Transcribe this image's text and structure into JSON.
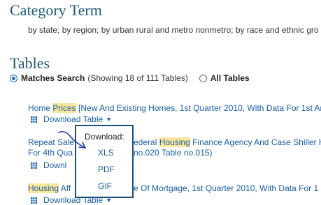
{
  "category": {
    "heading": "Category Term",
    "description": "by state; by region; by urban rural and metro nonmetro; by race and ethnic gro"
  },
  "tables": {
    "heading": "Tables",
    "matches_label": "Matches Search",
    "matches_count": "(Showing 18 of 111 Tables)",
    "all_label": "All Tables"
  },
  "results": [
    {
      "line1_pre": "Home ",
      "line1_hl": "Prices",
      "line1_post": " [New And Existing Homes, 1st Quarter 2010, With Data For 1st Ar"
    },
    {
      "line1_pre": "Repeat Sale",
      "line1_mid": "ederal ",
      "line1_hl": "Housing",
      "line1_post": " Finance Agency And Case Shiller H",
      "line2_pre": "For 4th Qua",
      "line2_post": "no.020 Table no.015)"
    },
    {
      "line1_hl": "Housing",
      "line1_pre": " Aff",
      "line1_post": "e Of Mortgage, 1st Quarter 2010, With Data For 1"
    }
  ],
  "download_label": "Download Table",
  "download_short": "Downl",
  "popup": {
    "title": "Download:",
    "options": [
      "XLS",
      "PDF",
      "GIF"
    ]
  },
  "colors": {
    "heading": "#1f5a78",
    "link": "#1a5fa6",
    "highlight": "#fbe79c",
    "popup_border": "#1a4f78"
  }
}
